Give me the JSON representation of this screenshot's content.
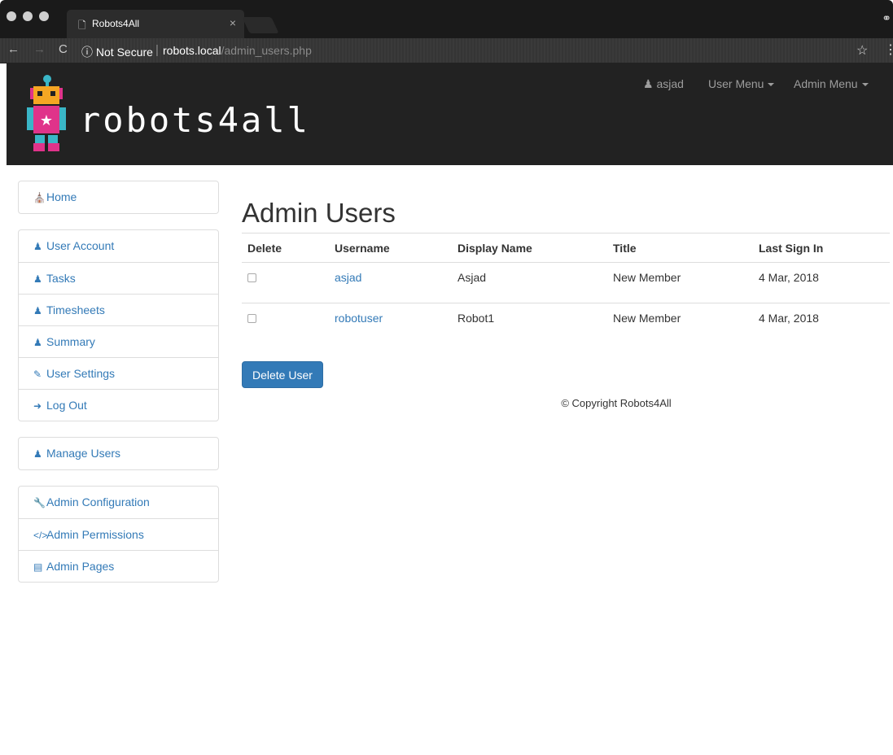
{
  "browser": {
    "tab_title": "Robots4All",
    "close_glyph": "×",
    "security_label": "ⓘ Not Secure",
    "url_host": "robots.local",
    "url_path": "/admin_users.php"
  },
  "header": {
    "logo_text": "robots4all",
    "user_name": "asjad",
    "user_menu": "User Menu",
    "admin_menu": "Admin Menu"
  },
  "sidebar": {
    "groups": [
      {
        "items": [
          {
            "label": "Home",
            "icon": "home-icon"
          }
        ]
      },
      {
        "items": [
          {
            "label": "User Account",
            "icon": "user-icon"
          },
          {
            "label": "Tasks",
            "icon": "user-icon"
          },
          {
            "label": "Timesheets",
            "icon": "user-icon"
          },
          {
            "label": "Summary",
            "icon": "user-icon"
          },
          {
            "label": "User Settings",
            "icon": "edit-icon"
          },
          {
            "label": "Log Out",
            "icon": "logout-icon"
          }
        ]
      },
      {
        "items": [
          {
            "label": "Manage Users",
            "icon": "users-icon"
          }
        ]
      },
      {
        "items": [
          {
            "label": "Admin Configuration",
            "icon": "wrench-icon"
          },
          {
            "label": "Admin Permissions",
            "icon": "code-icon"
          },
          {
            "label": "Admin Pages",
            "icon": "list-icon"
          }
        ]
      }
    ]
  },
  "main": {
    "title": "Admin Users",
    "columns": [
      "Delete",
      "Username",
      "Display Name",
      "Title",
      "Last Sign In"
    ],
    "rows": [
      {
        "username": "asjad",
        "display_name": "Asjad",
        "title": "New Member",
        "last_sign_in": "4 Mar, 2018"
      },
      {
        "username": "robotuser",
        "display_name": "Robot1",
        "title": "New Member",
        "last_sign_in": "4 Mar, 2018"
      }
    ],
    "delete_button": "Delete User"
  },
  "footer": {
    "copyright": "© Copyright Robots4All"
  },
  "colors": {
    "link": "#337ab7",
    "header_bg": "#222222",
    "button": "#337ab7"
  }
}
